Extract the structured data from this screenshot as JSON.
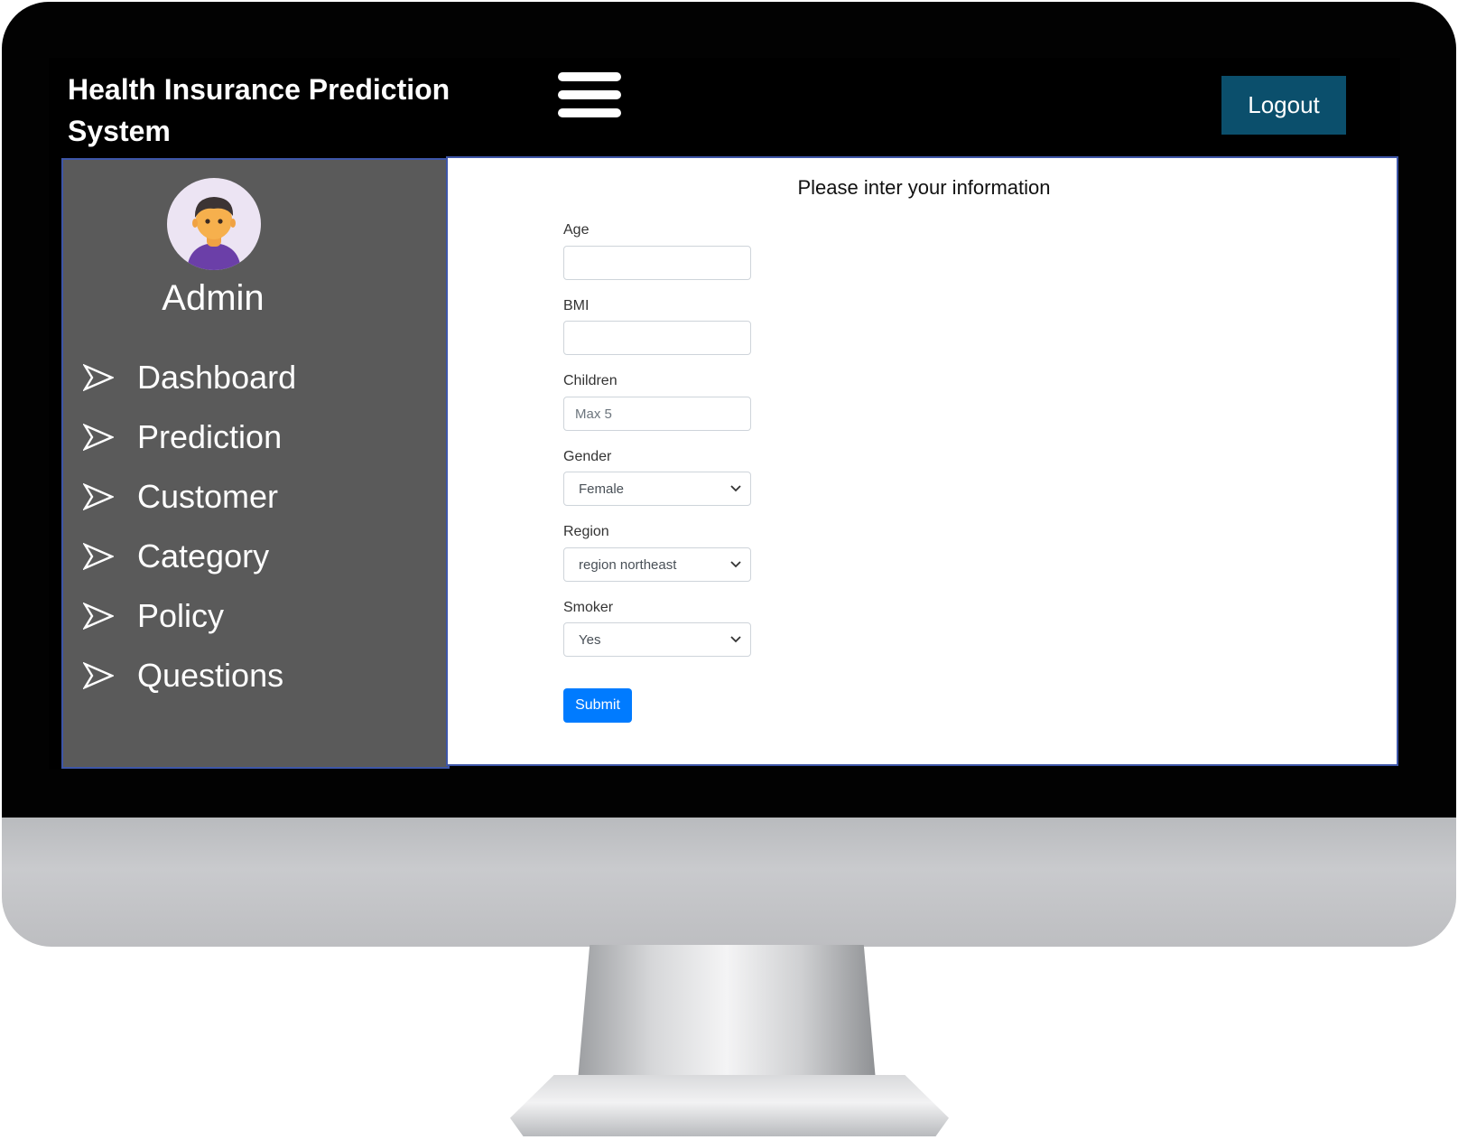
{
  "header": {
    "app_title": "Health Insurance Prediction System",
    "logout_label": "Logout"
  },
  "sidebar": {
    "user_name": "Admin",
    "items": [
      {
        "label": "Dashboard"
      },
      {
        "label": "Prediction"
      },
      {
        "label": "Customer"
      },
      {
        "label": "Category"
      },
      {
        "label": "Policy"
      },
      {
        "label": "Questions"
      }
    ]
  },
  "form": {
    "heading": "Please inter your information",
    "age": {
      "label": "Age",
      "value": "",
      "placeholder": ""
    },
    "bmi": {
      "label": "BMI",
      "value": "",
      "placeholder": ""
    },
    "children": {
      "label": "Children",
      "value": "",
      "placeholder": "Max 5"
    },
    "gender": {
      "label": "Gender",
      "selected": "Female"
    },
    "region": {
      "label": "Region",
      "selected": "region northeast"
    },
    "smoker": {
      "label": "Smoker",
      "selected": "Yes"
    },
    "submit_label": "Submit"
  },
  "colors": {
    "logout_bg": "#0b4f6c",
    "submit_bg": "#007bff",
    "sidebar_bg": "#5a5a5a",
    "panel_border": "#3e56a8"
  },
  "icons": {
    "menu": "hamburger-menu-icon",
    "avatar": "user-avatar-icon",
    "nav_bullet": "arrow-right-icon",
    "select": "chevron-down-icon"
  }
}
